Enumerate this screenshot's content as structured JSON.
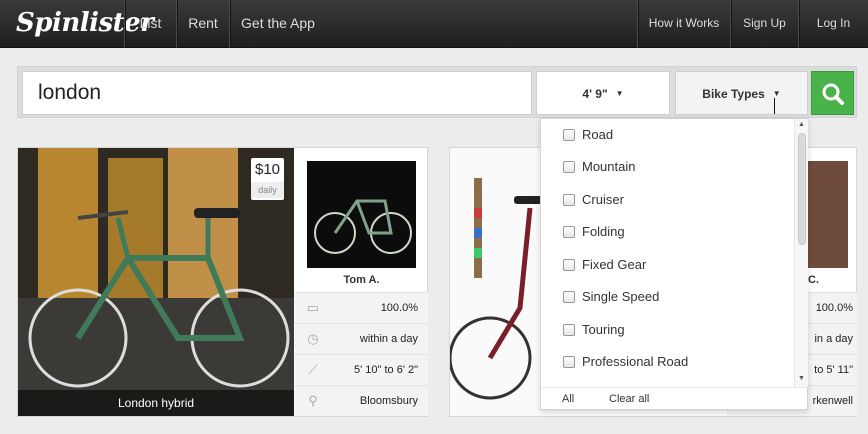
{
  "nav": {
    "logo": "Spinlister",
    "left_items": [
      "List",
      "Rent",
      "Get the App"
    ],
    "right_items": [
      "How it Works",
      "Sign Up",
      "Log In"
    ]
  },
  "search": {
    "location_value": "london",
    "height_value": "4' 9\"",
    "bike_types_label": "Bike Types",
    "search_icon": "search-icon",
    "button_color": "#49b349"
  },
  "listing1": {
    "price": "$10",
    "price_period": "daily",
    "title": "London hybrid",
    "owner": "Tom A.",
    "stats": [
      {
        "icon": "speech-bubble-icon",
        "value": "100.0%"
      },
      {
        "icon": "clock-icon",
        "value": "within a day"
      },
      {
        "icon": "ruler-icon",
        "value": "5' 10\" to 6' 2\""
      },
      {
        "icon": "map-pin-icon",
        "value": "Bloomsbury"
      }
    ]
  },
  "listing2": {
    "owner": "C.",
    "stats": [
      "100.0%",
      "in a day",
      "to 5' 11\"",
      "rkenwell"
    ]
  },
  "bike_types_dropdown": {
    "options": [
      "Road",
      "Mountain",
      "Cruiser",
      "Folding",
      "Fixed Gear",
      "Single Speed",
      "Touring",
      "Professional Road"
    ],
    "all_label": "All",
    "clear_label": "Clear all"
  }
}
